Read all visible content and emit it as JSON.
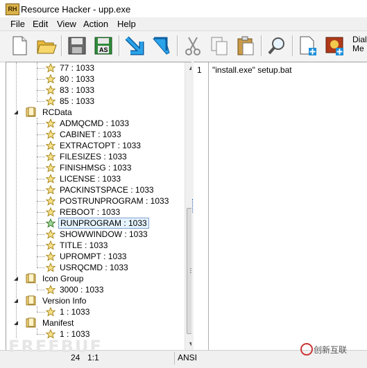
{
  "window": {
    "app_logo": "RH",
    "title": "Resource Hacker - upp.exe"
  },
  "menu": [
    "File",
    "Edit",
    "View",
    "Action",
    "Help"
  ],
  "toolbar": {
    "icons": [
      "new-file-icon",
      "open-folder-icon",
      "save-icon",
      "save-as-icon",
      "compile-icon",
      "goto-icon",
      "cut-icon",
      "copy-icon",
      "paste-icon",
      "find-icon",
      "add-resource-icon",
      "add-image-icon"
    ],
    "save_as_label": "AS",
    "dialog_label_line1": "Dialo",
    "dialog_label_line2": "Me"
  },
  "tree": {
    "top_items": [
      "77 : 1033",
      "80 : 1033",
      "83 : 1033",
      "85 : 1033"
    ],
    "rcdata": {
      "label": "RCData",
      "items": [
        "ADMQCMD : 1033",
        "CABINET : 1033",
        "EXTRACTOPT : 1033",
        "FILESIZES : 1033",
        "FINISHMSG : 1033",
        "LICENSE : 1033",
        "PACKINSTSPACE : 1033",
        "POSTRUNPROGRAM : 1033",
        "REBOOT : 1033",
        "RUNPROGRAM : 1033",
        "SHOWWINDOW : 1033",
        "TITLE : 1033",
        "UPROMPT : 1033",
        "USRQCMD : 1033"
      ],
      "selected_index": 9
    },
    "icon_group": {
      "label": "Icon Group",
      "items": [
        "3000 : 1033"
      ]
    },
    "version_info": {
      "label": "Version Info",
      "items": [
        "1 : 1033"
      ]
    },
    "manifest": {
      "label": "Manifest",
      "items": [
        "1 : 1033"
      ]
    }
  },
  "editor": {
    "line_number": "1",
    "line_text": "\"install.exe\" setup.bat"
  },
  "status": {
    "position": "24",
    "cursor": "1:1",
    "encoding": "ANSI"
  },
  "watermarks": {
    "left": "FREEBUF",
    "right": "创新互联"
  },
  "colors": {
    "selection_bg": "#e5f3ff",
    "selection_border": "#7da2ce",
    "folder": "#e8c04a",
    "star": "#e9c84a",
    "toolbar_blue": "#1e8fd8"
  }
}
